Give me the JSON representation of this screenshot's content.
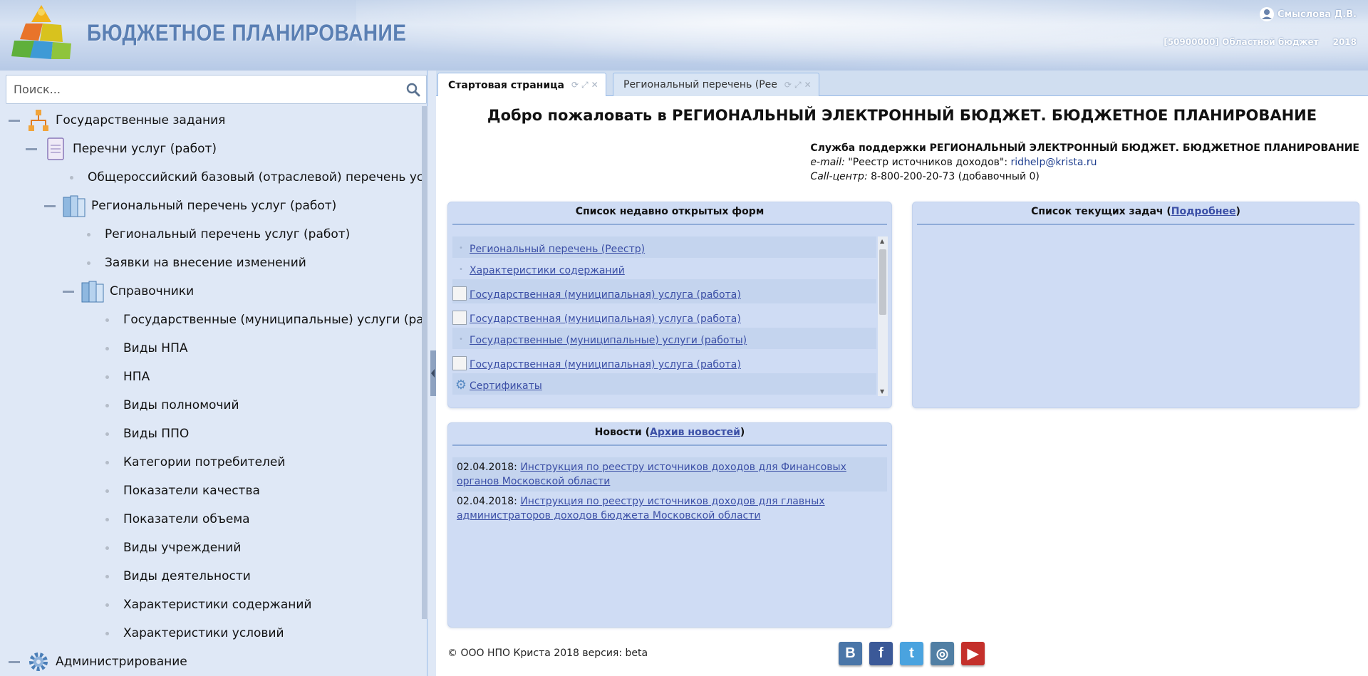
{
  "header": {
    "app_title": "БЮДЖЕТНОЕ ПЛАНИРОВАНИЕ",
    "user_name": "Смыслова Д.В.",
    "budget": "[50900000] Областной бюджет",
    "year": "2018"
  },
  "search": {
    "placeholder": "Поиск..."
  },
  "tree": [
    {
      "label": "Государственные задания",
      "kind": "toggle-icon",
      "icon": "hierarchy-icon"
    },
    {
      "label": "Перечни услуг (работ)",
      "kind": "toggle-icon",
      "icon": "document-icon"
    },
    {
      "label": "Общероссийский базовый (отраслевой) перечень услуг",
      "kind": "leaf"
    },
    {
      "label": "Региональный перечень услуг (работ)",
      "kind": "toggle-icon",
      "icon": "books-icon"
    },
    {
      "label": "Региональный перечень услуг (работ)",
      "kind": "leaf"
    },
    {
      "label": "Заявки на внесение изменений",
      "kind": "leaf"
    },
    {
      "label": "Справочники",
      "kind": "toggle-icon",
      "icon": "books-icon"
    },
    {
      "label": "Государственные (муниципальные) услуги (работы)",
      "kind": "leaf"
    },
    {
      "label": "Виды НПА",
      "kind": "leaf"
    },
    {
      "label": "НПА",
      "kind": "leaf"
    },
    {
      "label": "Виды полномочий",
      "kind": "leaf"
    },
    {
      "label": "Виды ППО",
      "kind": "leaf"
    },
    {
      "label": "Категории потребителей",
      "kind": "leaf"
    },
    {
      "label": "Показатели качества",
      "kind": "leaf"
    },
    {
      "label": "Показатели объема",
      "kind": "leaf"
    },
    {
      "label": "Виды учреждений",
      "kind": "leaf"
    },
    {
      "label": "Виды деятельности",
      "kind": "leaf"
    },
    {
      "label": "Характеристики содержаний",
      "kind": "leaf"
    },
    {
      "label": "Характеристики условий",
      "kind": "leaf"
    },
    {
      "label": "Администрирование",
      "kind": "toggle-icon",
      "icon": "gear-icon"
    }
  ],
  "tabs": [
    {
      "label": "Стартовая страница",
      "active": true
    },
    {
      "label": "Региональный перечень (Рее",
      "active": false
    }
  ],
  "welcome": "Добро пожаловать в РЕГИОНАЛЬНЫЙ ЭЛЕКТРОННЫЙ БЮДЖЕТ. БЮДЖЕТНОЕ ПЛАНИРОВАНИЕ",
  "support": {
    "title": "Служба поддержки РЕГИОНАЛЬНЫЙ ЭЛЕКТРОННЫЙ БЮДЖЕТ. БЮДЖЕТНОЕ ПЛАНИРОВАНИЕ",
    "email_label": "e-mail:",
    "email_desc": "\"Реестр источников доходов\":",
    "email": "ridhelp@krista.ru",
    "call_label": "Call-центр:",
    "call": "8-800-200-20-73 (добавочный 0)"
  },
  "recent": {
    "title": "Список недавно открытых форм",
    "items": [
      {
        "label": "Региональный перечень (Реестр)",
        "icon": "dot-icon"
      },
      {
        "label": "Характеристики содержаний",
        "icon": "dot-icon"
      },
      {
        "label": "Государственная (муниципальная) услуга (работа)",
        "icon": "broken-image-icon"
      },
      {
        "label": "Государственная (муниципальная) услуга (работа)",
        "icon": "broken-image-icon"
      },
      {
        "label": "Государственные (муниципальные) услуги (работы)",
        "icon": "dot-icon"
      },
      {
        "label": "Государственная (муниципальная) услуга (работа)",
        "icon": "broken-image-icon"
      },
      {
        "label": "Сертификаты",
        "icon": "gear-icon"
      }
    ]
  },
  "tasks": {
    "title": "Список текущих задач (",
    "link": "Подробнее",
    "title_end": ")"
  },
  "news": {
    "title": "Новости (",
    "link": "Архив новостей",
    "title_end": ")",
    "items": [
      {
        "date": "02.04.2018:",
        "text": "Инструкция по реестру источников доходов для Финансовых органов Московской области"
      },
      {
        "date": "02.04.2018:",
        "text": "Инструкция по реестру источников доходов для главных администраторов доходов бюджета Московской области"
      }
    ]
  },
  "footer": {
    "copyright": "© ООО НПО Криста 2018 версия: beta",
    "social": [
      {
        "name": "vk-icon",
        "glyph": "B",
        "color": "#4a76a8"
      },
      {
        "name": "facebook-icon",
        "glyph": "f",
        "color": "#3b5998"
      },
      {
        "name": "twitter-icon",
        "glyph": "t",
        "color": "#4aa3df"
      },
      {
        "name": "instagram-icon",
        "glyph": "◎",
        "color": "#517fa4"
      },
      {
        "name": "youtube-icon",
        "glyph": "▶",
        "color": "#c4302b"
      }
    ]
  }
}
